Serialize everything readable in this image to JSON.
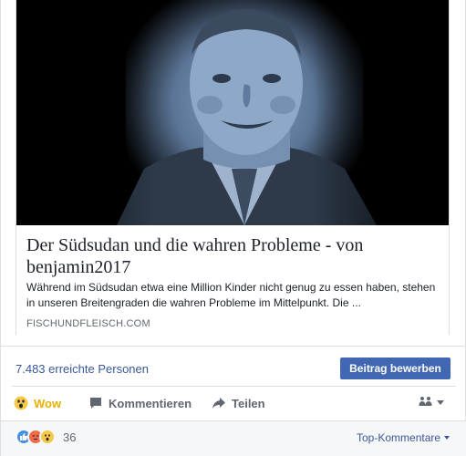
{
  "link_preview": {
    "title": "Der Südsudan und die wahren Probleme - von benjamin2017",
    "description": "Während im Südsudan etwa eine Million Kinder nicht genug zu essen haben, stehen in unseren Breitengraden die wahren Probleme im Mittelpunkt. Die ...",
    "domain": "FISCHUNDFLEISCH.COM",
    "image_tint": "#6e8fb5"
  },
  "insights": {
    "reach_text": "7.483 erreichte Personen",
    "boost_label": "Beitrag bewerben"
  },
  "actions": {
    "wow_label": "Wow",
    "comment_label": "Kommentieren",
    "share_label": "Teilen"
  },
  "reactions": {
    "icons": [
      "like-icon",
      "angry-icon",
      "wow-icon"
    ],
    "count": "36",
    "sort_label": "Top-Kommentare"
  },
  "colors": {
    "link_blue": "#385898",
    "button_blue": "#4267b2",
    "wow_yellow": "#e9b000",
    "muted": "#606770"
  }
}
